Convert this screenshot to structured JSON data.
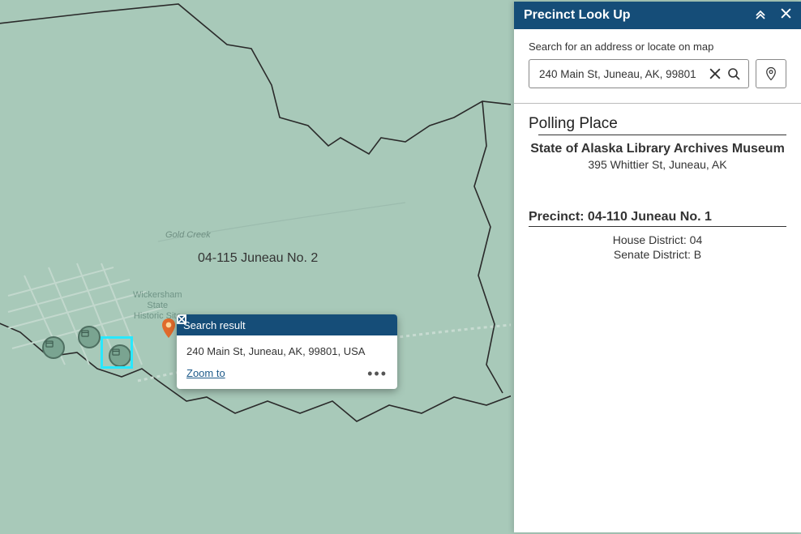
{
  "panel": {
    "title": "Precinct Look Up",
    "search_label": "Search for an address or locate on map",
    "search_value": "240 Main St, Juneau, AK, 99801",
    "polling_heading": "Polling Place",
    "polling_name": "State of Alaska Library Archives Museum",
    "polling_addr": "395 Whittier St, Juneau, AK",
    "precinct_heading": "Precinct: 04-110 Juneau No. 1",
    "house": "House District: 04",
    "senate": "Senate District: B"
  },
  "popup": {
    "title": "Search result",
    "address": "240 Main St, Juneau, AK, 99801, USA",
    "zoom_label": "Zoom to"
  },
  "map": {
    "district_label": "04-115 Juneau No. 2",
    "creek_label": "Gold Creek",
    "site_label_l1": "Wickersham",
    "site_label_l2": "State",
    "site_label_l3": "Historic Site"
  }
}
